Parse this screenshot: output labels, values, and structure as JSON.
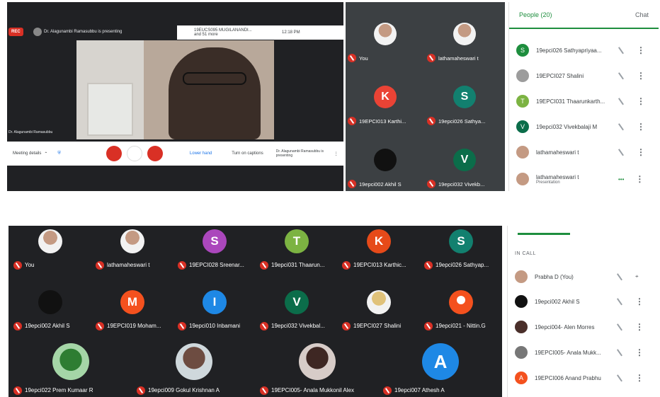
{
  "top": {
    "rec": "REC",
    "presenting": "Dr. Alagunambi Ramasubbu is presenting",
    "pinned_note": "19EUCS095 MUGILANANDI... and 51 more",
    "time": "12:18 PM",
    "presenter_name": "Dr. Alagunambi Ramasubbu",
    "meeting_details": "Meeting details",
    "lower_hand": "Lower hand",
    "turn_on_captions": "Turn on captions",
    "present_now": "Dr. Alagunambi Ramasubbu is presenting",
    "tiles": [
      {
        "label": "You"
      },
      {
        "label": "lathamaheswari t"
      },
      {
        "initial": "K",
        "color": "#ea4335",
        "label": "19EPCI013 Karthi..."
      },
      {
        "initial": "S",
        "color": "#12806f",
        "label": "19epci026 Sathya..."
      },
      {
        "label": "19epci002 Akhil S"
      },
      {
        "initial": "V",
        "color": "#0b6d4a",
        "label": "19epci032 Vivekb..."
      }
    ],
    "people": {
      "tab_people": "People (20)",
      "tab_chat": "Chat",
      "rows": [
        {
          "initial": "S",
          "color": "#1e8e3e",
          "name": "19epci026 Sathyapriyaa..."
        },
        {
          "initial": "",
          "color": "#9c9c9c",
          "name": "19EPCI027 Shalini"
        },
        {
          "initial": "T",
          "color": "#7cb342",
          "name": "19EPCI031 Thaarunkarth..."
        },
        {
          "initial": "V",
          "color": "#0b6d4a",
          "name": "19epci032 Vivekbalaji M"
        },
        {
          "initial": "",
          "color": "#c49a83",
          "name": "lathamaheswari t"
        },
        {
          "initial": "",
          "color": "#c49a83",
          "name": "lathamaheswari t",
          "sub": "Presentation"
        }
      ]
    }
  },
  "bottom": {
    "tiles": [
      {
        "label": "You"
      },
      {
        "label": "lathamaheswari t"
      },
      {
        "initial": "S",
        "color": "#ab47bc",
        "label": "19EPCI028 Sreenar..."
      },
      {
        "initial": "T",
        "color": "#7cb342",
        "label": "19epci031 Thaarun..."
      },
      {
        "initial": "K",
        "color": "#e64a19",
        "label": "19EPCI013 Karthic..."
      },
      {
        "initial": "S",
        "color": "#12806f",
        "label": "19epci026 Sathyap..."
      },
      {
        "label": "19epci002 Akhil S"
      },
      {
        "initial": "M",
        "color": "#f4511e",
        "label": "19EPCI019 Moham..."
      },
      {
        "initial": "I",
        "color": "#1e88e5",
        "label": "19epci010 Inbamani"
      },
      {
        "initial": "V",
        "color": "#0b6d4a",
        "label": "19epci032 Vivekbal..."
      },
      {
        "label": "19EPCI027 Shalini"
      },
      {
        "initial": "",
        "color": "#f4511e",
        "label": "19epci021 - Nittin.G"
      },
      {
        "label": "19epci022 Prem Kumaar R"
      },
      {
        "label": "19epci009 Gokul Krishnan A"
      },
      {
        "label": "19EPCI005- Anala Mukkonil Alex"
      },
      {
        "initial": "A",
        "color": "#1e88e5",
        "label": "19epci007 Athesh A"
      }
    ],
    "people": {
      "in_call": "IN CALL",
      "rows": [
        {
          "initial": "",
          "color": "#c49a83",
          "name": "Prabha D (You)"
        },
        {
          "initial": "",
          "color": "#111111",
          "name": "19epci002 Akhil S"
        },
        {
          "initial": "",
          "color": "#4a2f2a",
          "name": "19epci004- Alen Morres"
        },
        {
          "initial": "",
          "color": "#777777",
          "name": "19EPCI005- Anala Mukk..."
        },
        {
          "initial": "A",
          "color": "#f4511e",
          "name": "19EPCI006 Anand Prabhu"
        }
      ]
    }
  }
}
